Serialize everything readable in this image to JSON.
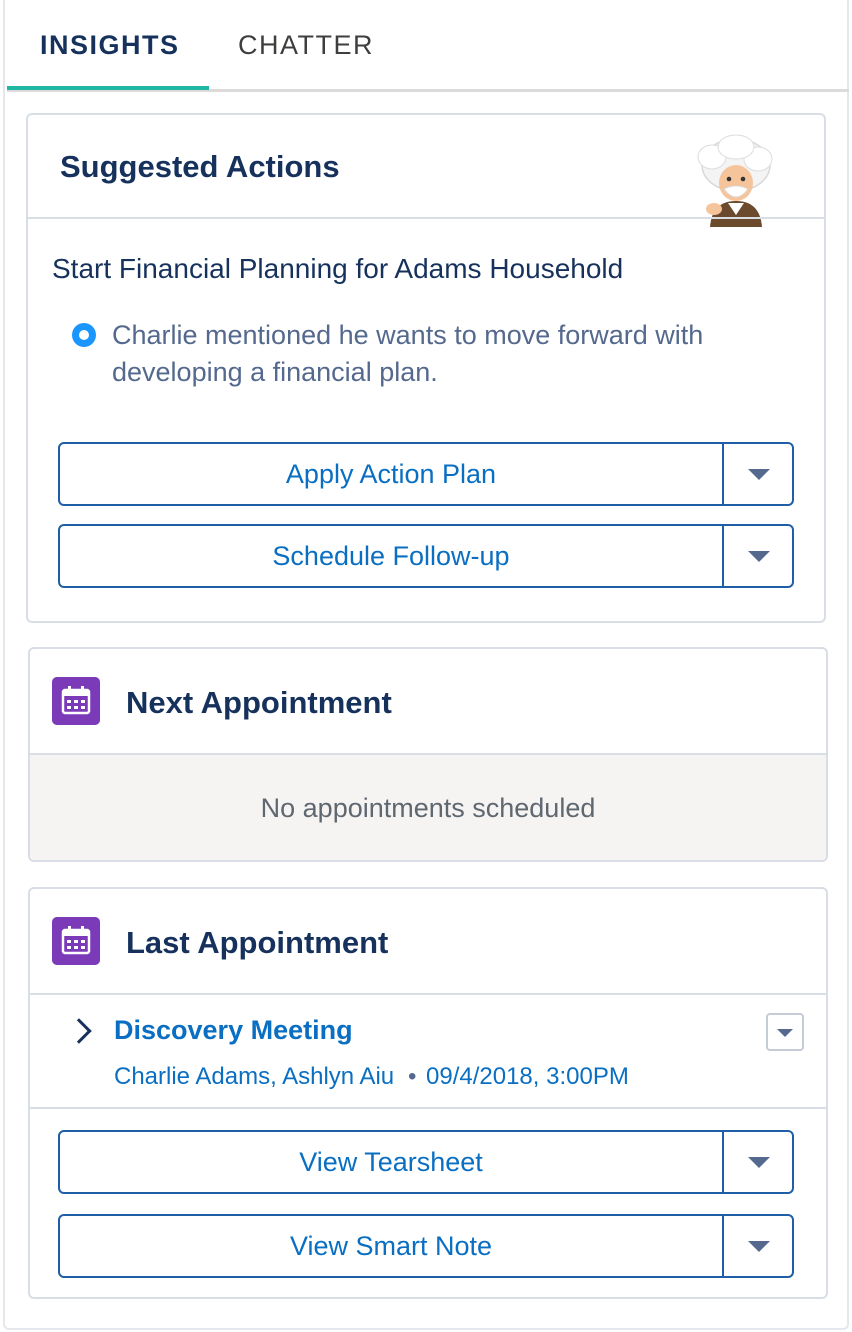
{
  "tabs": [
    {
      "label": "INSIGHTS",
      "active": true
    },
    {
      "label": "CHATTER",
      "active": false
    }
  ],
  "suggested_actions": {
    "title": "Suggested Actions",
    "avatar_icon": "einstein-avatar-icon",
    "heading": "Start Financial Planning for Adams Household",
    "insight": "Charlie mentioned he wants to move forward with developing a financial plan.",
    "buttons": [
      {
        "label": "Apply Action Plan"
      },
      {
        "label": "Schedule Follow-up"
      }
    ]
  },
  "next_appointment": {
    "title": "Next Appointment",
    "icon": "calendar-icon",
    "empty_text": "No appointments scheduled"
  },
  "last_appointment": {
    "title": "Last Appointment",
    "icon": "calendar-icon",
    "meeting": {
      "name": "Discovery Meeting",
      "people": "Charlie Adams, Ashlyn Aiu",
      "separator": "•",
      "datetime": "09/4/2018, 3:00PM"
    },
    "buttons": [
      {
        "label": "View Tearsheet"
      },
      {
        "label": "View Smart Note"
      }
    ]
  },
  "colors": {
    "accent_tab": "#1fb8a4",
    "link": "#0a6fc2",
    "calendar_icon_bg": "#7b3ab8",
    "radio": "#1b96ff"
  }
}
